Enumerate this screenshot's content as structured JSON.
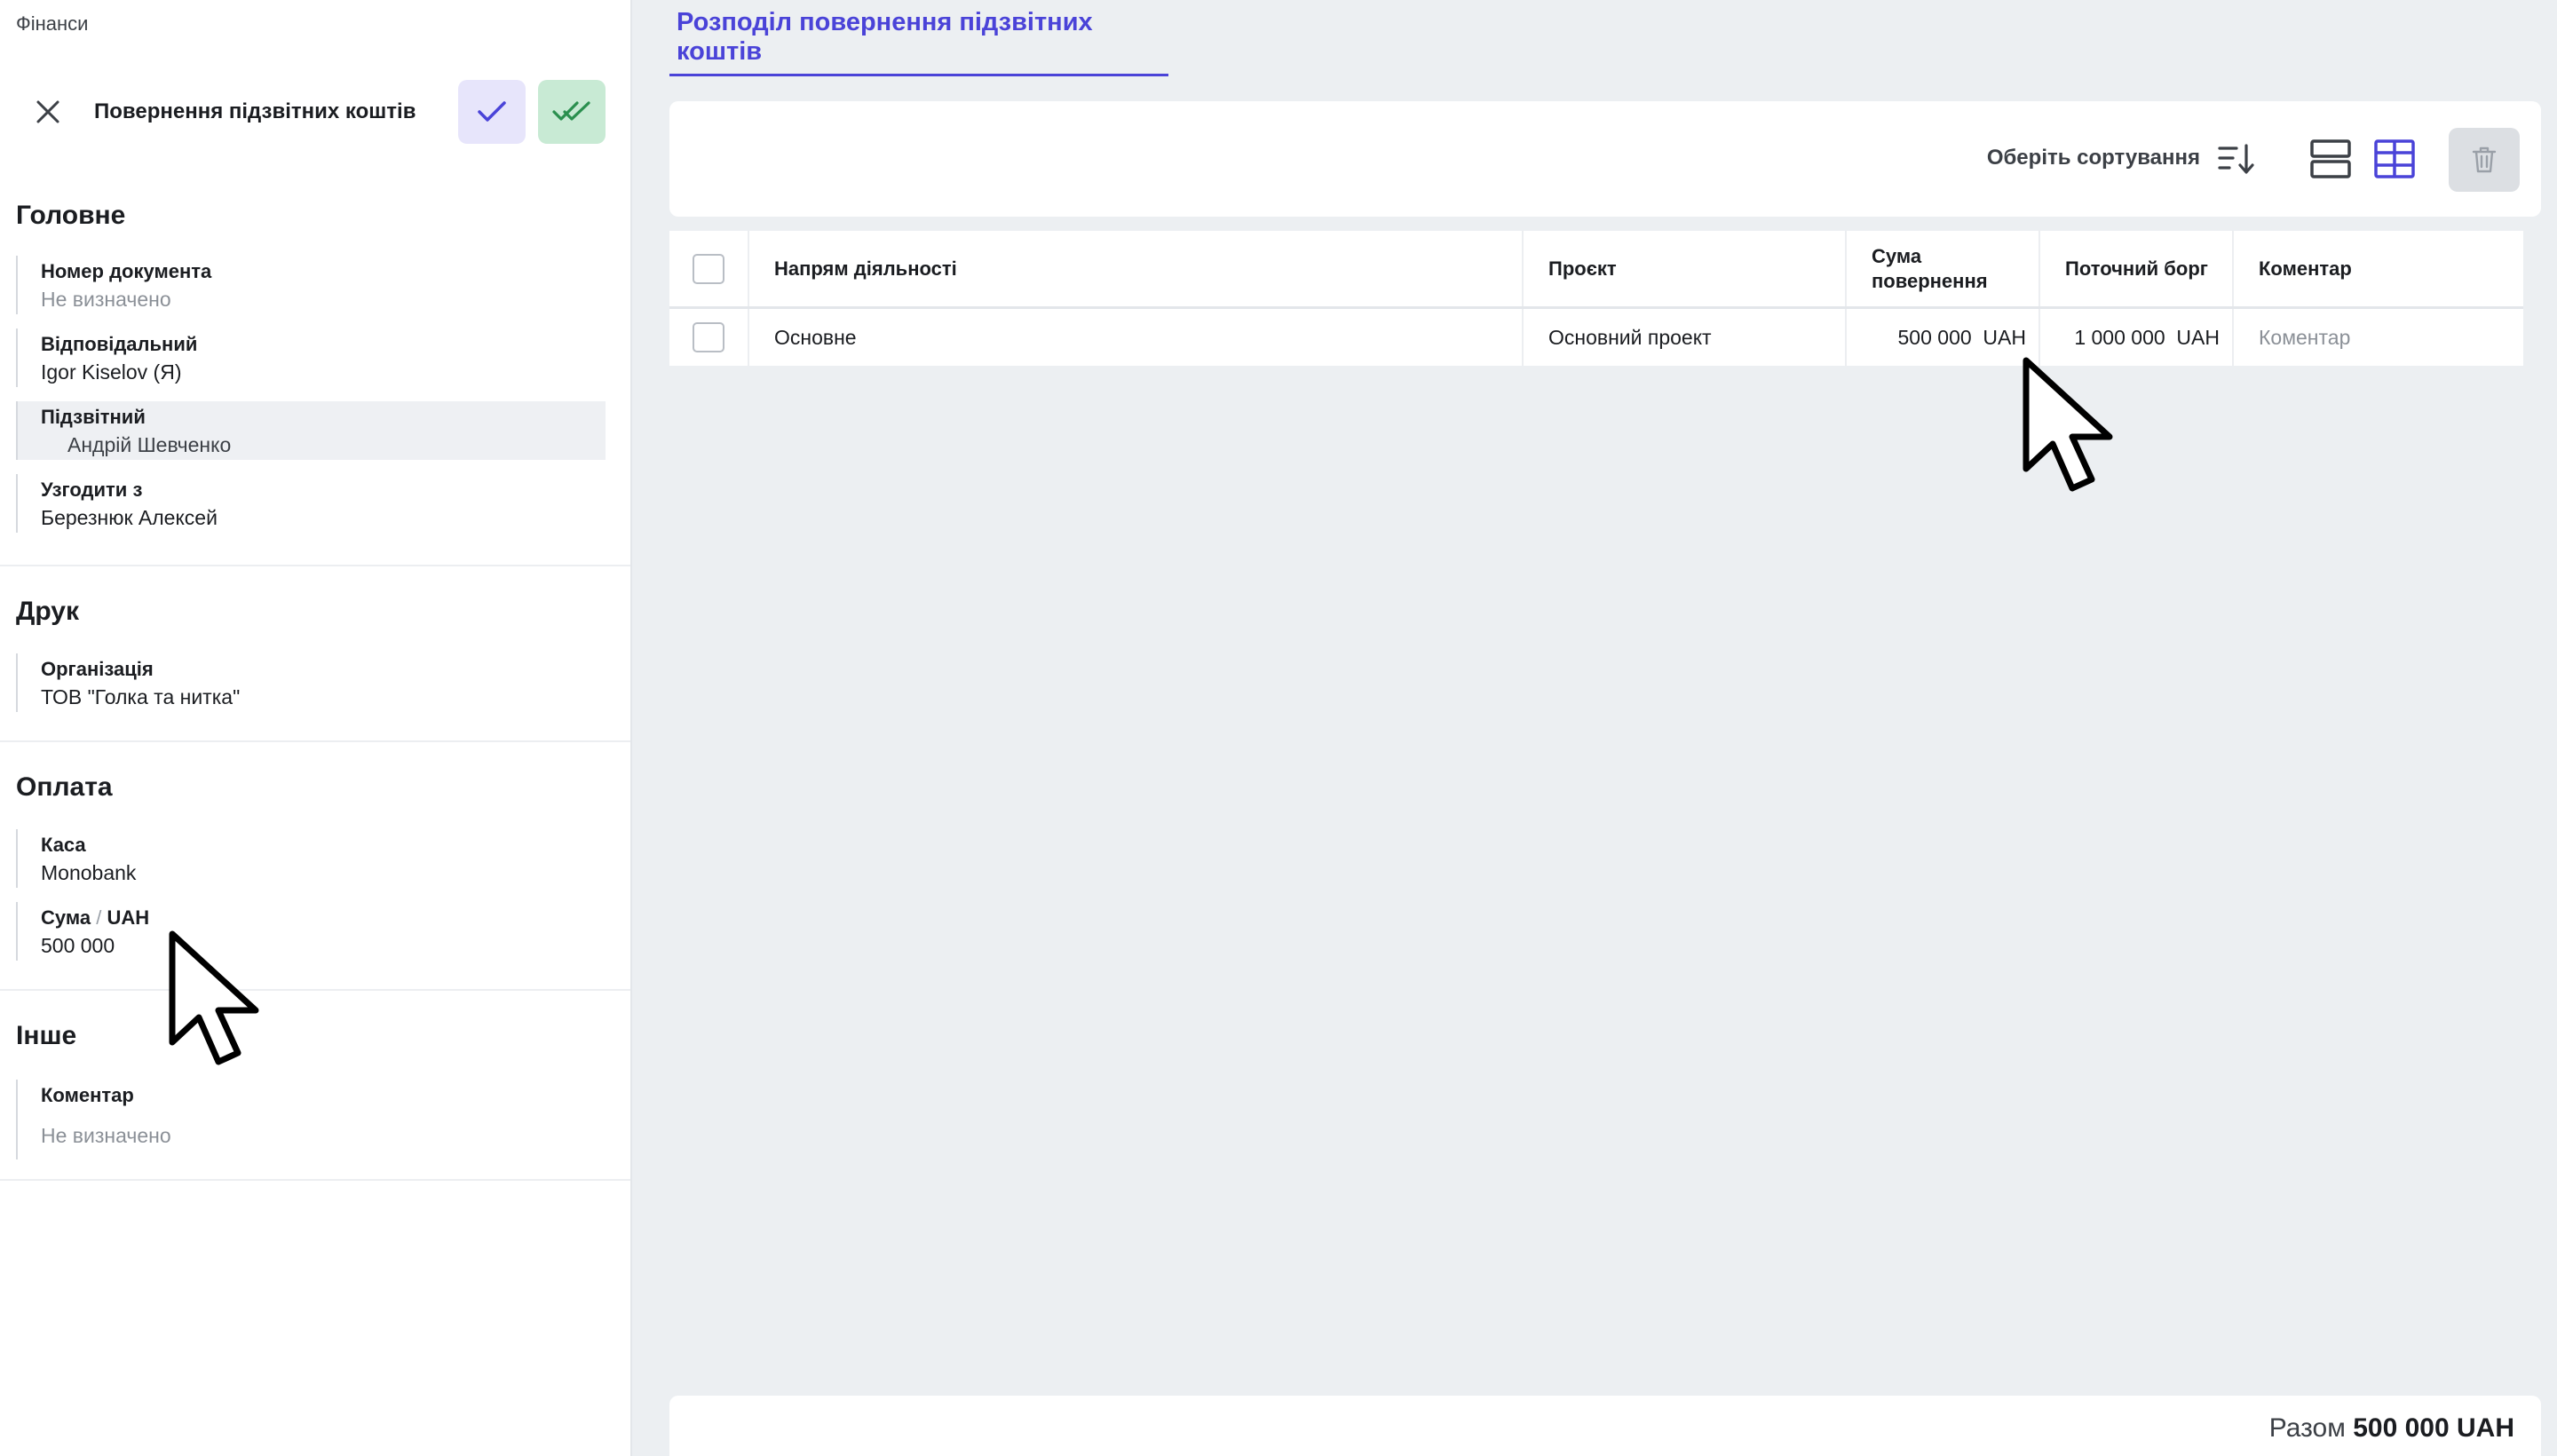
{
  "breadcrumb": "Фінанси",
  "document": {
    "title": "Повернення підзвітних коштів"
  },
  "sections": {
    "main": {
      "title": "Головне",
      "doc_number": {
        "label": "Номер документа",
        "value": "Не визначено"
      },
      "responsible": {
        "label": "Відповідальний",
        "value": "Igor Kiselov (Я)"
      },
      "accountable": {
        "label": "Підзвітний",
        "value": "Андрій Шевченко"
      },
      "approve_with": {
        "label": "Узгодити з",
        "value": "Березнюк Алексей"
      }
    },
    "print": {
      "title": "Друк",
      "organization": {
        "label": "Організація",
        "value": "ТОВ \"Голка та нитка\""
      }
    },
    "payment": {
      "title": "Оплата",
      "cashbox": {
        "label": "Каса",
        "value": "Monobank"
      },
      "amount": {
        "label": "Сума",
        "separator": "/",
        "unit": "UAH",
        "value": "500 000"
      }
    },
    "other": {
      "title": "Інше",
      "comment": {
        "label": "Коментар",
        "value": "Не визначено"
      }
    }
  },
  "tab": {
    "label": "Розподіл повернення підзвітних коштів"
  },
  "toolbar": {
    "sort_label": "Оберіть сортування",
    "icons": [
      "sort-descending-icon",
      "rows-view-icon",
      "grid-view-icon",
      "trash-icon"
    ]
  },
  "table": {
    "headers": {
      "direction": "Напрям діяльності",
      "project": "Проєкт",
      "return_sum_1": "Сума",
      "return_sum_2": "повернення",
      "current_debt": "Поточний борг",
      "comment": "Коментар"
    },
    "rows": [
      {
        "direction": "Основне",
        "project": "Основний проект",
        "return_sum": "500 000  UAH",
        "current_debt": "1 000 000  UAH",
        "comment": "Коментар"
      }
    ]
  },
  "footer": {
    "total_label": "Разом",
    "total_value": "500 000 UAH"
  },
  "colors": {
    "accent": "#4a43d8",
    "approve_bg": "#e7e5fb",
    "approve_all_bg": "#c8ead4",
    "approve_all_fg": "#2a8f4e"
  }
}
